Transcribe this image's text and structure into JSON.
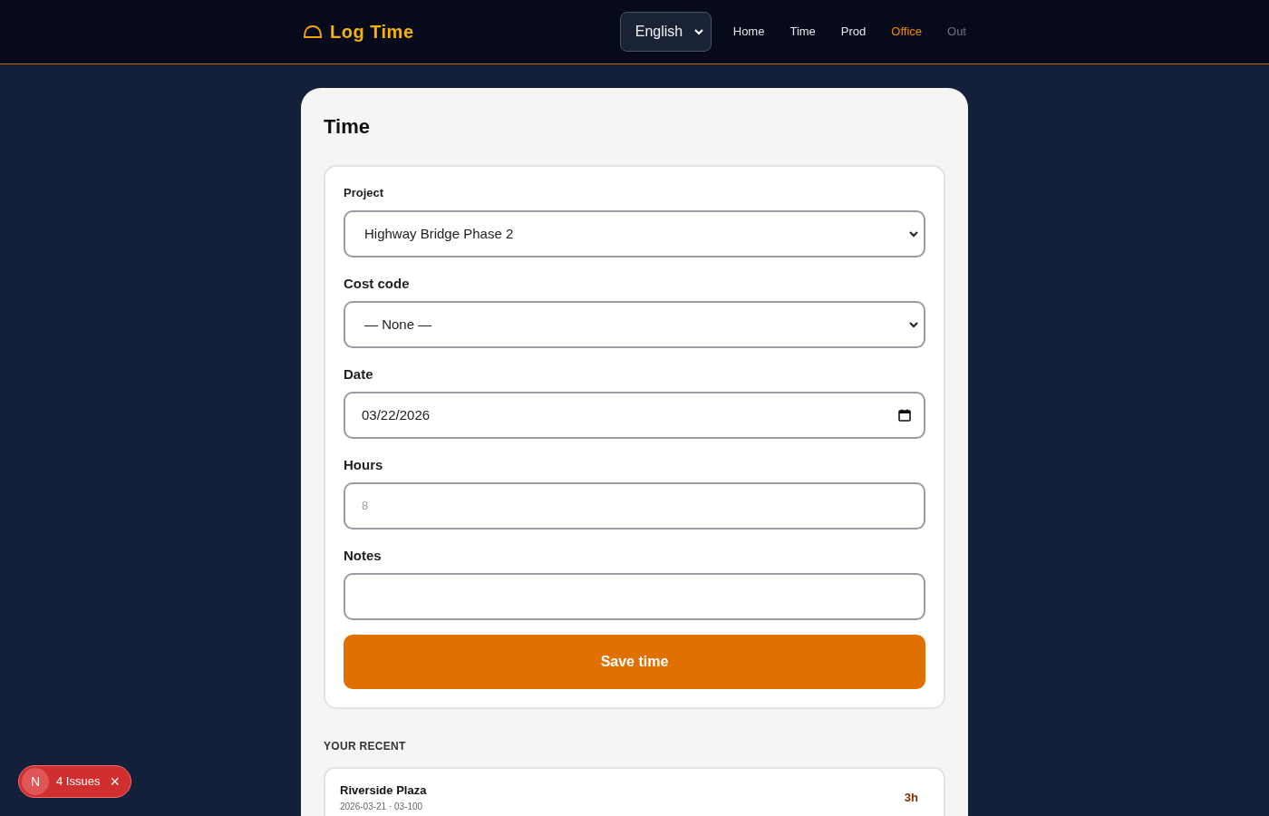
{
  "header": {
    "logo": "Log Time",
    "language": "English",
    "nav": [
      {
        "label": "Home",
        "selected": false,
        "disabled": false
      },
      {
        "label": "Time",
        "selected": false,
        "disabled": false
      },
      {
        "label": "Prod",
        "selected": false,
        "disabled": false
      },
      {
        "label": "Office",
        "selected": true,
        "disabled": false
      },
      {
        "label": "Out",
        "selected": false,
        "disabled": true
      }
    ]
  },
  "page": {
    "title": "Time"
  },
  "form": {
    "fields": [
      {
        "kind": "select",
        "label": "Project",
        "value": "Highway Bridge Phase 2"
      },
      {
        "kind": "select",
        "label": "Cost code",
        "value": "— None —"
      },
      {
        "kind": "date",
        "label": "Date",
        "value": "03/22/2026"
      },
      {
        "kind": "number",
        "label": "Hours",
        "placeholder": "8"
      },
      {
        "kind": "text",
        "label": "Notes"
      }
    ],
    "submit": "Save time"
  },
  "recent": {
    "heading": "YOUR RECENT",
    "entries": [
      {
        "project": "Riverside Plaza",
        "meta": "2026-03-21 · 03-100",
        "hours": "3h"
      }
    ]
  },
  "issues_badge": {
    "logo": "N",
    "label": "4 Issues",
    "close": "×"
  }
}
